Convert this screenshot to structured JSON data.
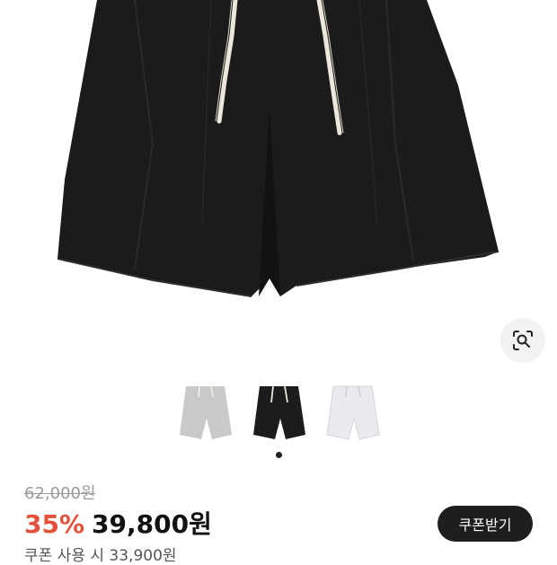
{
  "product": {
    "original_price": "62,000원",
    "discount_rate": "35%",
    "sale_price": "39,800원",
    "coupon_button_label": "쿠폰받기",
    "coupon_price_note": "쿠폰 사용 시 33,900원"
  },
  "gallery": {
    "thumbnails": [
      {
        "color_name": "gray",
        "color": "#c9c9c7"
      },
      {
        "color_name": "black",
        "color": "#1c1c1c"
      },
      {
        "color_name": "white",
        "color": "#e9e9ee"
      }
    ],
    "selected_index": 1,
    "lens_icon": "lens-search-icon"
  },
  "colors": {
    "discount": "#e4513b",
    "button_bg": "#1e1e1e",
    "strike_price": "#9a9a9a"
  }
}
